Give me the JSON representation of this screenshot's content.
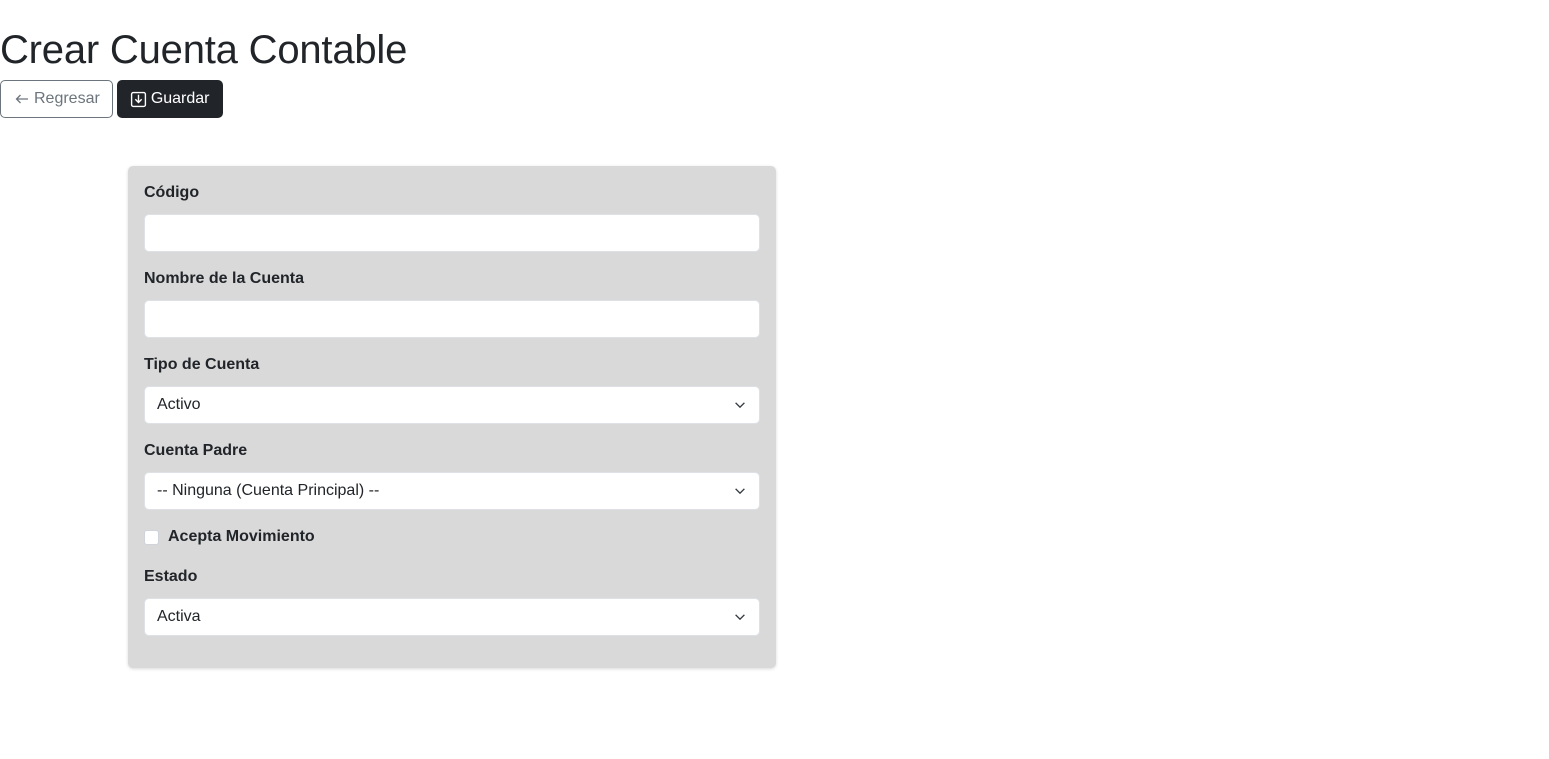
{
  "header": {
    "title": "Crear Cuenta Contable"
  },
  "toolbar": {
    "back_label": "Regresar",
    "back_icon": "arrow-left-icon",
    "save_label": "Guardar",
    "save_icon": "download-box-icon"
  },
  "form": {
    "codigo": {
      "label": "Código",
      "value": ""
    },
    "nombre": {
      "label": "Nombre de la Cuenta",
      "value": ""
    },
    "tipo": {
      "label": "Tipo de Cuenta",
      "selected": "Activo"
    },
    "padre": {
      "label": "Cuenta Padre",
      "selected": "-- Ninguna (Cuenta Principal) --"
    },
    "movimiento": {
      "label": "Acepta Movimiento",
      "checked": false
    },
    "estado": {
      "label": "Estado",
      "selected": "Activa"
    }
  },
  "colors": {
    "card_bg": "#d9d9d9",
    "primary_dark": "#212529",
    "secondary": "#6c757d"
  }
}
